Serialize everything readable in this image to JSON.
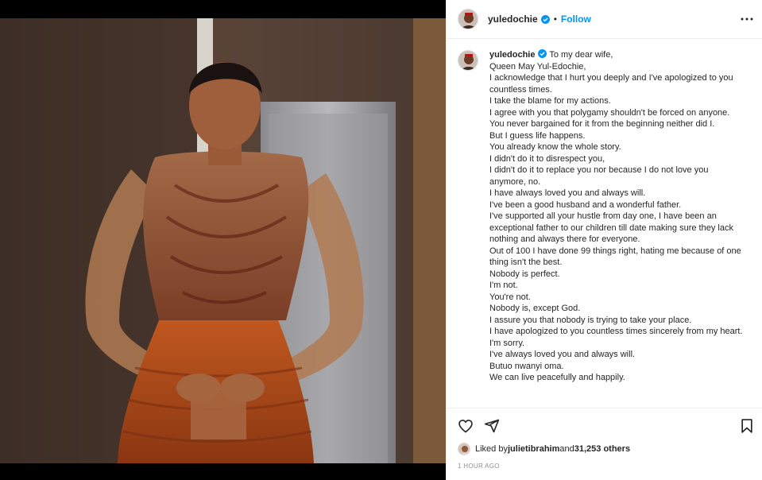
{
  "post": {
    "username": "yuledochie",
    "follow_label": "Follow",
    "separator": "•",
    "verified": true
  },
  "caption": {
    "username": "yuledochie",
    "lines": [
      "To my dear wife,",
      "Queen May Yul-Edochie,",
      "I acknowledge that I hurt you deeply and I've apologized to you countless times.",
      "I take the blame for my actions.",
      "I agree with you that polygamy shouldn't be forced on anyone.",
      "You never bargained for it from the beginning neither did I.",
      "But I guess life happens.",
      "You already know the whole story.",
      "I didn't do it to disrespect you,",
      "I didn't do it to replace you nor because I do not love you anymore, no.",
      "I have always loved you and always will.",
      "I've been a good husband and a wonderful father.",
      "I've supported all your hustle from day one, I have been an exceptional father to our children till date making sure they lack nothing and always there for everyone.",
      "Out of 100 I have done 99 things right, hating me because of one thing isn't the best.",
      "Nobody is perfect.",
      "I'm not.",
      "You're not.",
      "Nobody is, except God.",
      "I assure you that nobody is trying to take your place.",
      "I have apologized to you countless times sincerely from my heart.",
      "I'm sorry.",
      "I've always loved you and always will.",
      "Butuo nwanyi oma.",
      "We can live peacefully and happily."
    ]
  },
  "likes": {
    "prefix": "Liked by ",
    "user": "julietibrahim",
    "middle": " and ",
    "count": "31,253 others"
  },
  "timestamp": "1 HOUR AGO",
  "icons": {
    "more": "more-options-icon",
    "like": "heart-icon",
    "share": "paper-plane-icon",
    "save": "bookmark-icon",
    "verified": "verified-badge-icon"
  },
  "colors": {
    "accent": "#0095f6",
    "text": "#262626",
    "muted": "#8e8e8e",
    "border": "#efefef"
  }
}
